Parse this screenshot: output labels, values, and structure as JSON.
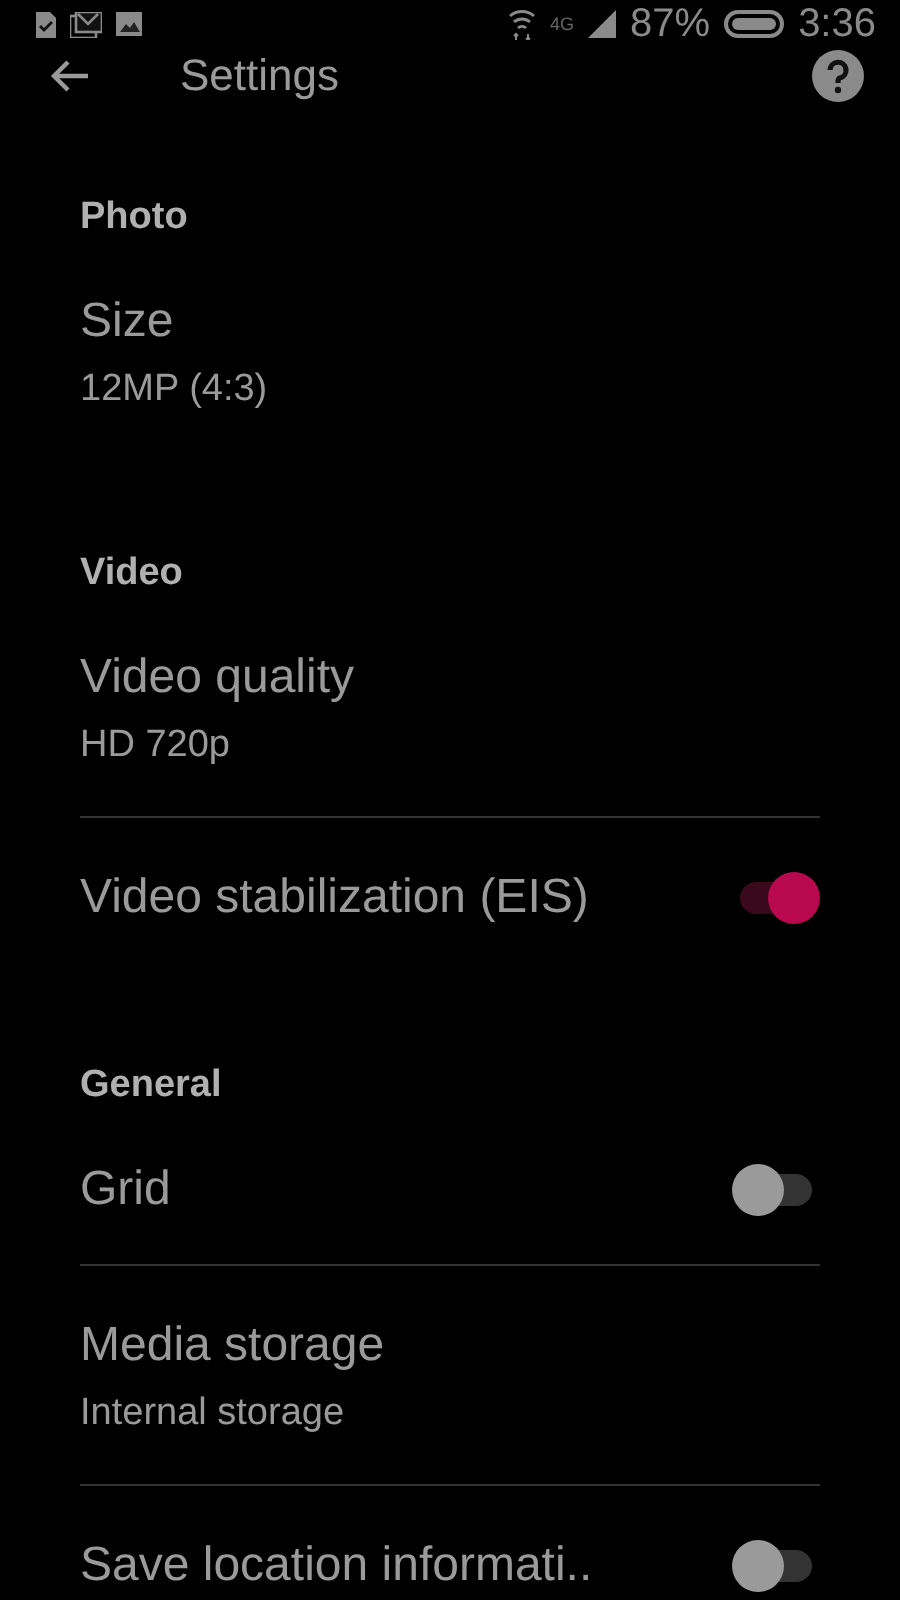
{
  "status_bar": {
    "network": "4G",
    "battery": "87%",
    "time": "3:36"
  },
  "app_bar": {
    "title": "Settings"
  },
  "sections": [
    {
      "header": "Photo",
      "items": [
        {
          "kind": "value",
          "title": "Size",
          "value": "12MP (4:3)"
        }
      ]
    },
    {
      "header": "Video",
      "items": [
        {
          "kind": "value",
          "title": "Video quality",
          "value": "HD 720p"
        },
        {
          "kind": "switch",
          "title": "Video stabilization (EIS)",
          "on": true
        }
      ]
    },
    {
      "header": "General",
      "items": [
        {
          "kind": "switch",
          "title": "Grid",
          "on": false
        },
        {
          "kind": "value",
          "title": "Media storage",
          "value": "Internal storage"
        },
        {
          "kind": "switch",
          "title": "Save location informati..",
          "on": false
        }
      ]
    }
  ]
}
